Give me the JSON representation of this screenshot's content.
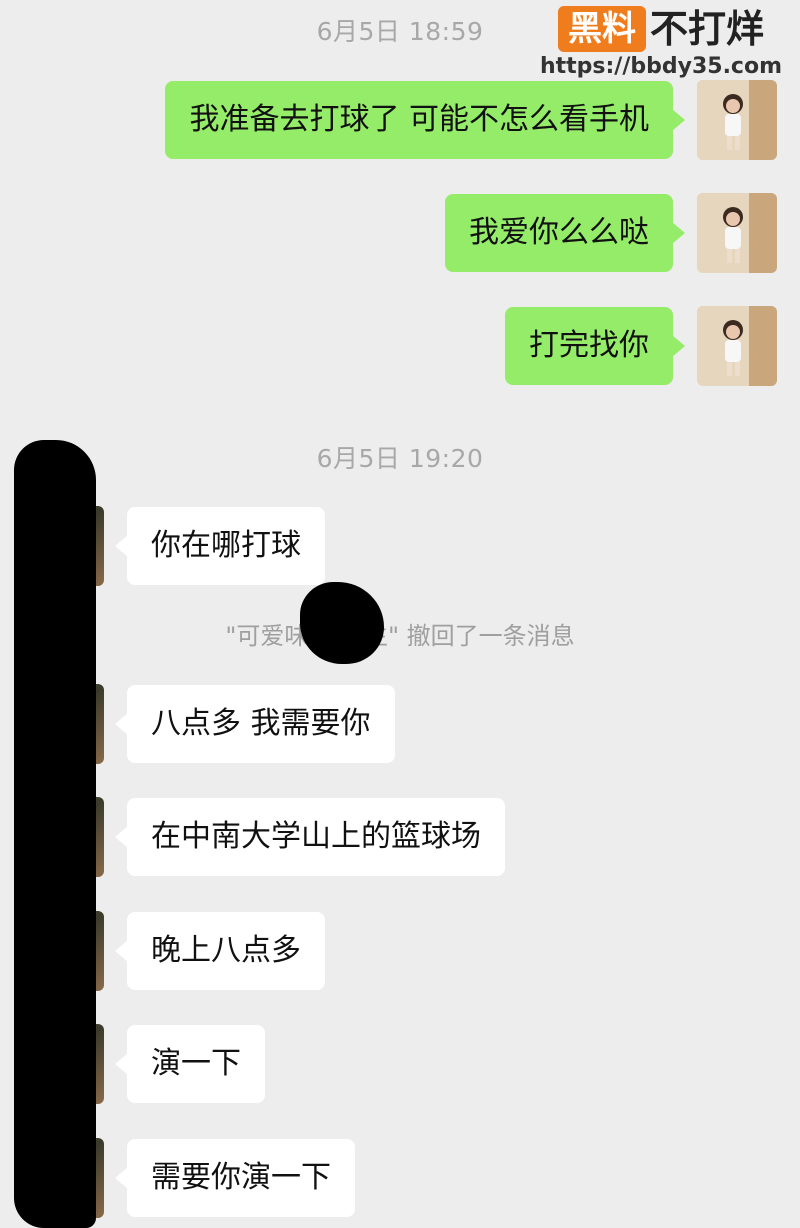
{
  "watermark": {
    "badge": "黑料",
    "text": "不打烊",
    "url": "https://bbdy35.com"
  },
  "timestamps": [
    "6月5日 18:59",
    "6月5日 19:20"
  ],
  "sent_messages": [
    "我准备去打球了 可能不怎么看手机",
    "我爱你么么哒",
    "打完找你"
  ],
  "received_messages_before": [
    "你在哪打球"
  ],
  "system_message": "\"可爱味的      先生\" 撤回了一条消息",
  "received_messages_after": [
    "八点多 我需要你",
    "在中南大学山上的篮球场",
    "晚上八点多",
    "演一下",
    "需要你演一下"
  ],
  "colors": {
    "background": "#ededed",
    "sent_bubble": "#95ec69",
    "received_bubble": "#ffffff",
    "timestamp_text": "#a8a8a8",
    "watermark_badge": "#f07d1d"
  }
}
